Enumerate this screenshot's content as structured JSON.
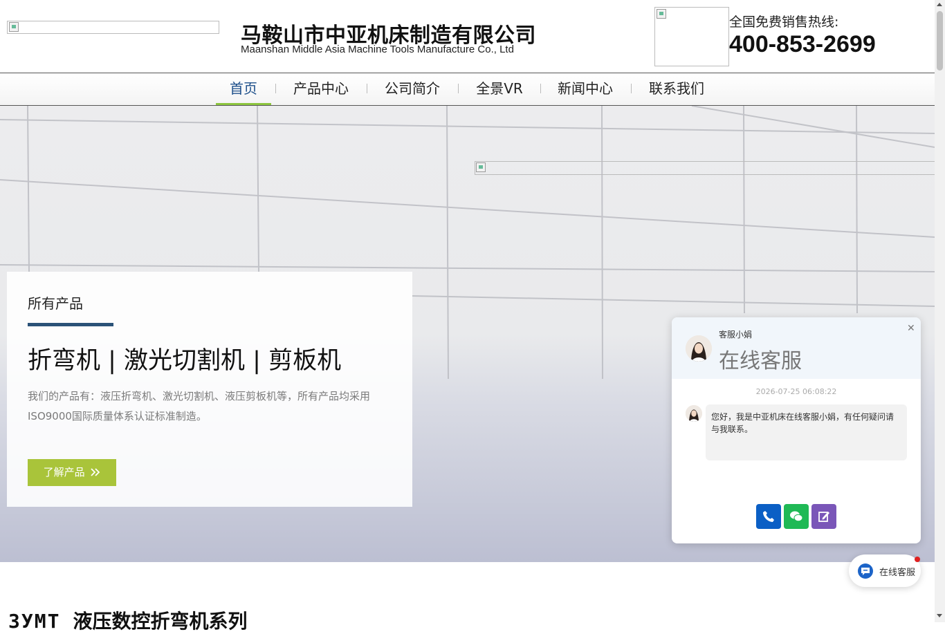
{
  "header": {
    "logo_icon": "broken-image-icon",
    "company_name_cn": "马鞍山市中亚机床制造有限公司",
    "company_name_en": "Maanshan Middle Asia Machine Tools Manufacture Co., Ltd",
    "hotline_label": "全国免费销售热线:",
    "hotline_number": "400-853-2699"
  },
  "nav": {
    "items": [
      {
        "label": "首页",
        "active": true
      },
      {
        "label": "产品中心"
      },
      {
        "label": "公司简介"
      },
      {
        "label": "全景VR"
      },
      {
        "label": "新闻中心"
      },
      {
        "label": "联系我们"
      }
    ],
    "accent_color": "#8dc63f",
    "active_color": "#1d4f8a"
  },
  "hero": {
    "kicker": "所有产品",
    "title": "折弯机 | 激光切割机 | 剪板机",
    "description": "我们的产品有：液压折弯机、激光切割机、液压剪板机等，所有产品均采用ISO9000国际质量体系认证标准制造。",
    "button_label": "了解产品",
    "button_icon": "double-chevron-right-icon",
    "button_color": "#a9c43a",
    "rule_color": "#2b5278"
  },
  "section": {
    "title_en": "ЗУМТ",
    "title_cn": "液压数控折弯机系列"
  },
  "chat": {
    "agent_name": "客服小娟",
    "title": "在线客服",
    "close_icon": "close-icon",
    "timestamp": "2026-07-25 06:08:22",
    "message": "您好，我是中亚机床在线客服小娟，有任何疑问请与我联系。",
    "buttons": [
      {
        "icon": "phone-icon",
        "color": "#0b5fc5"
      },
      {
        "icon": "wechat-icon",
        "color": "#1fb955"
      },
      {
        "icon": "edit-icon",
        "color": "#7a56b8"
      }
    ]
  },
  "float_service": {
    "label": "在线客服",
    "icon": "chat-bubble-icon"
  }
}
